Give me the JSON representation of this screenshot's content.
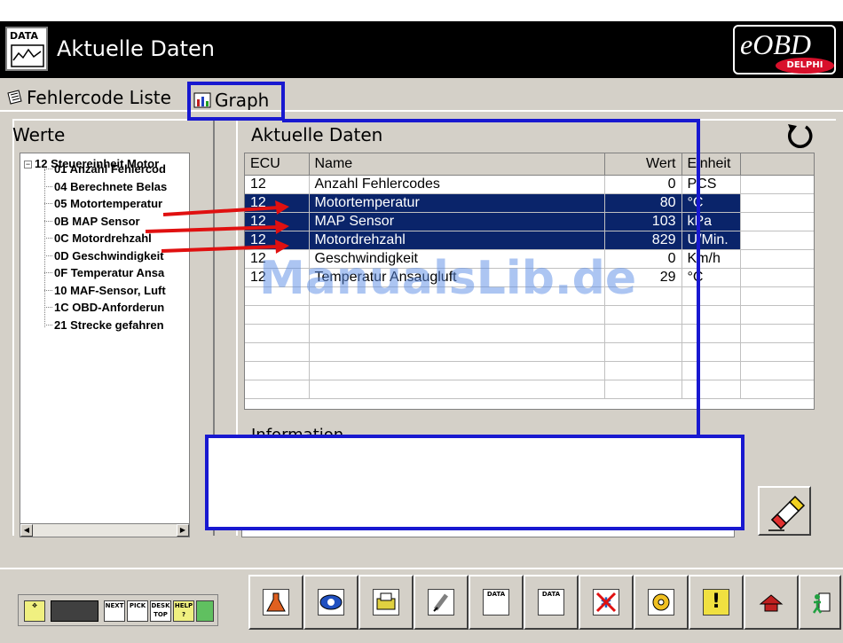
{
  "app": {
    "title": "Aktuelle Daten",
    "icon_label": "DATA",
    "logo_text": "eOBD",
    "logo_brand": "DELPHI"
  },
  "tabs": [
    {
      "label": "Fehlercode Liste",
      "icon": "document-list-icon"
    },
    {
      "label": "Graph",
      "icon": "graph-icon"
    }
  ],
  "left_panel": {
    "title": "Werte",
    "tree": {
      "root": "12 Steuereinheit Motor",
      "items": [
        "01 Anzahl Fehlercod",
        "04 Berechnete Belas",
        "05 Motortemperatur",
        "0B MAP Sensor",
        "0C Motordrehzahl",
        "0D Geschwindigkeit",
        "0F Temperatur Ansa",
        "10 MAF-Sensor, Luft",
        "1C OBD-Anforderun",
        "21 Strecke gefahren"
      ]
    }
  },
  "right_panel": {
    "title": "Aktuelle Daten",
    "refresh_icon": "refresh-icon",
    "columns": [
      "ECU",
      "Name",
      "Wert",
      "Einheit"
    ],
    "rows": [
      {
        "ecu": "12",
        "name": "Anzahl Fehlercodes",
        "value": "0",
        "unit": "PCS",
        "selected": false
      },
      {
        "ecu": "12",
        "name": "Motortemperatur",
        "value": "80",
        "unit": "°C",
        "selected": true
      },
      {
        "ecu": "12",
        "name": "MAP Sensor",
        "value": "103",
        "unit": "kPa",
        "selected": true
      },
      {
        "ecu": "12",
        "name": "Motordrehzahl",
        "value": "829",
        "unit": "U/Min.",
        "selected": true
      },
      {
        "ecu": "12",
        "name": "Geschwindigkeit",
        "value": "0",
        "unit": "Km/h",
        "selected": false
      },
      {
        "ecu": "12",
        "name": "Temperatur Ansaugluft",
        "value": "29",
        "unit": "°C",
        "selected": false
      }
    ],
    "information_label": "Information"
  },
  "watermark": "ManualsLib.de",
  "toolbar": {
    "mini_buttons": [
      "NEXT",
      "PICK",
      "DESK TOP",
      "HELP ?"
    ],
    "tool_icons": [
      "flask-icon",
      "eye-icon",
      "printer-icon",
      "spark-plug-icon",
      "data-freeze-icon",
      "data-record-icon",
      "no-snow-icon",
      "sensor-icon",
      "warning-icon",
      "home-icon",
      "exit-icon"
    ],
    "tool_labels": [
      "",
      "",
      "",
      "",
      "DATA",
      "DATA",
      "",
      "",
      "!",
      "",
      ""
    ]
  },
  "colors": {
    "titlebar": "#000000",
    "panel": "#d4d0c8",
    "selection": "#0a246a",
    "annotation_blue": "#1818d0",
    "annotation_red": "#e01010",
    "delphi_red": "#d8102b"
  }
}
